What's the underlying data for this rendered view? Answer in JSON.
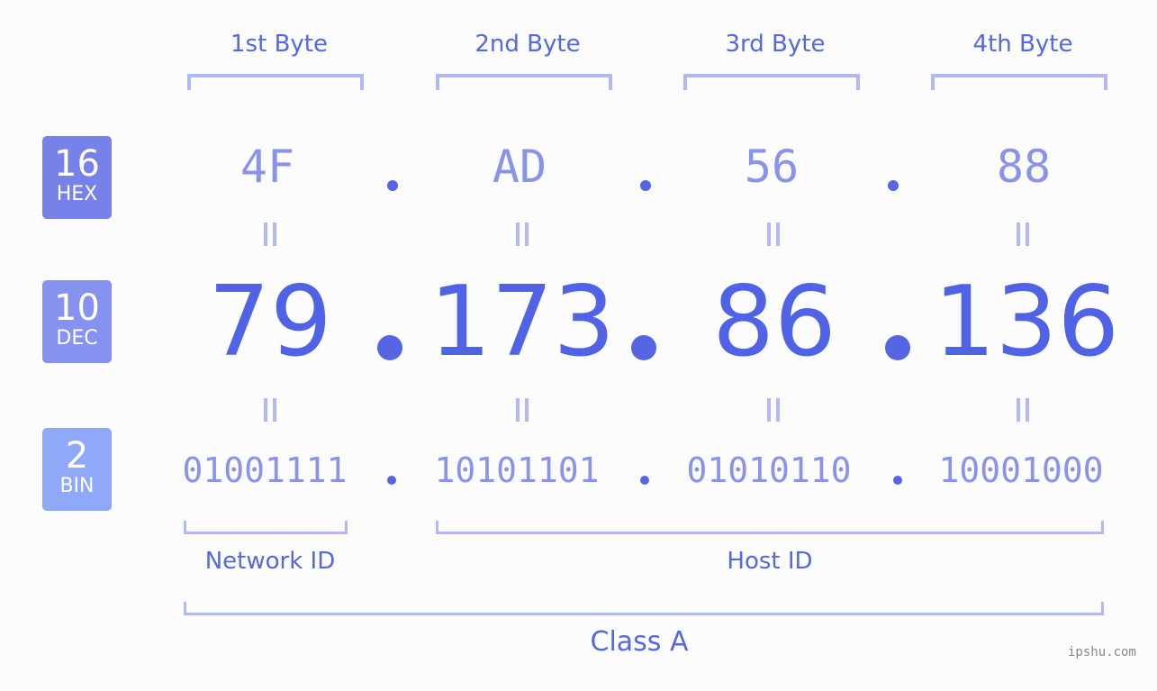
{
  "bases": [
    {
      "num": "16",
      "label": "HEX",
      "color": "#7682ea"
    },
    {
      "num": "10",
      "label": "DEC",
      "color": "#8592f0"
    },
    {
      "num": "2",
      "label": "BIN",
      "color": "#8fa8f8"
    }
  ],
  "bytes": [
    {
      "header": "1st Byte",
      "hex": "4F",
      "dec": "79",
      "bin": "01001111"
    },
    {
      "header": "2nd Byte",
      "hex": "AD",
      "dec": "173",
      "bin": "10101101"
    },
    {
      "header": "3rd Byte",
      "hex": "56",
      "dec": "86",
      "bin": "01010110"
    },
    {
      "header": "4th Byte",
      "hex": "88",
      "dec": "136",
      "bin": "10001000"
    }
  ],
  "ip_address": "79.173.86.136",
  "labels": {
    "network_id": "Network ID",
    "host_id": "Host ID",
    "class": "Class A"
  },
  "watermark": "ipshu.com"
}
